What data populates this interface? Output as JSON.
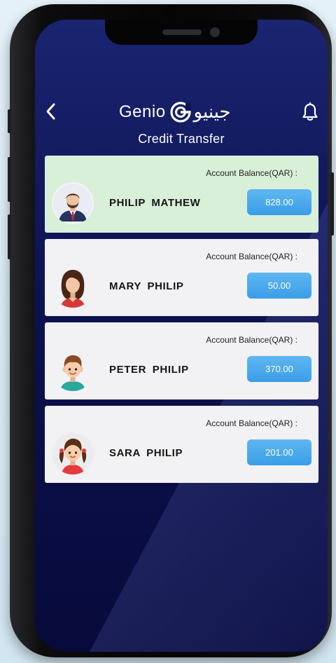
{
  "header": {
    "brand_en": "Genio",
    "brand_ar": "جينيو",
    "title": "Credit Transfer"
  },
  "icons": {
    "back": "chevron-left-icon",
    "notifications": "bell-icon",
    "logo": "genio-logo-icon"
  },
  "colors": {
    "screen_bg": "#0c1250",
    "selected_card": "#d8efd8",
    "card": "#f2f2f4",
    "balance_button": "#3a9de8"
  },
  "accounts": [
    {
      "name": "PHILIP  MATHEW",
      "balance_label": "Account Balance(QAR) :",
      "balance": "828.00",
      "selected": true
    },
    {
      "name": "MARY  PHILIP",
      "balance_label": "Account Balance(QAR) :",
      "balance": "50.00",
      "selected": false
    },
    {
      "name": "PETER  PHILIP",
      "balance_label": "Account Balance(QAR) :",
      "balance": "370.00",
      "selected": false
    },
    {
      "name": "SARA  PHILIP",
      "balance_label": "Account Balance(QAR) :",
      "balance": "201.00",
      "selected": false
    }
  ]
}
